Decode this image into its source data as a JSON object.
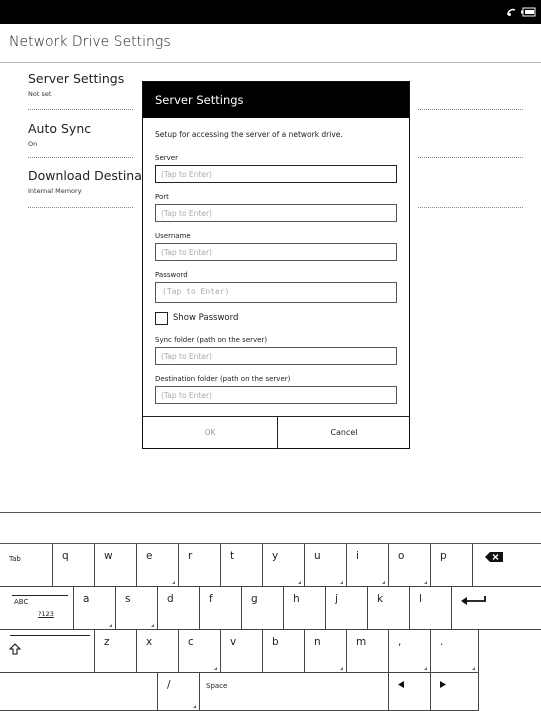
{
  "status_bar": {
    "icons": [
      "wifi-icon",
      "battery-icon"
    ]
  },
  "header": {
    "title": "Network Drive Settings"
  },
  "settings": [
    {
      "title": "Server Settings",
      "value": "Not set"
    },
    {
      "title": "Auto Sync",
      "value": "On"
    },
    {
      "title": "Download Destina",
      "value": "Internal Memory"
    }
  ],
  "dialog": {
    "title": "Server Settings",
    "description": "Setup for accessing the server of a network drive.",
    "fields": [
      {
        "label": "Server",
        "placeholder": "(Tap to Enter)"
      },
      {
        "label": "Port",
        "placeholder": "(Tap to Enter)"
      },
      {
        "label": "Username",
        "placeholder": "(Tap to Enter)"
      },
      {
        "label": "Password",
        "placeholder": "(Tap to Enter)"
      },
      {
        "label": "Sync folder (path on the server)",
        "placeholder": "(Tap to Enter)"
      },
      {
        "label": "Destination folder (path on the server)",
        "placeholder": "(Tap to Enter)"
      }
    ],
    "show_password_label": "Show Password",
    "ok_label": "OK",
    "cancel_label": "Cancel"
  },
  "keyboard": {
    "row1": [
      "Tab",
      "q",
      "w",
      "e",
      "r",
      "t",
      "y",
      "u",
      "i",
      "o",
      "p",
      "backspace-icon"
    ],
    "row2": [
      "ABC",
      "?123",
      "a",
      "s",
      "d",
      "f",
      "g",
      "h",
      "j",
      "k",
      "l",
      "enter-icon"
    ],
    "row3": [
      "shift-icon",
      "z",
      "x",
      "c",
      "v",
      "b",
      "n",
      "m",
      ",",
      "."
    ],
    "row4": [
      "/",
      "Space",
      "left-arrow-icon",
      "right-arrow-icon"
    ]
  }
}
